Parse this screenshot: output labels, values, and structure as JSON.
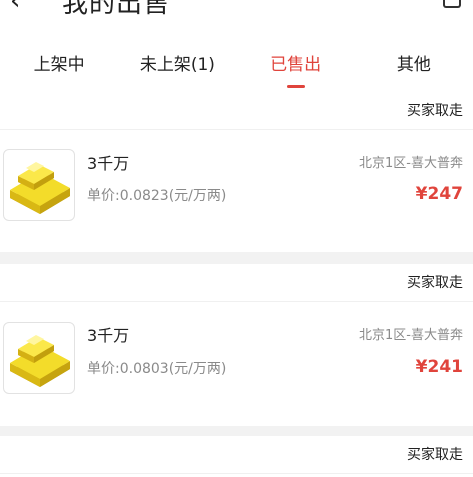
{
  "header": {
    "back_icon": "chevron-left-icon",
    "title": "我的出售",
    "menu_icon": "menu-icon"
  },
  "tabs": [
    {
      "label": "上架中",
      "active": false
    },
    {
      "label": "未上架(1)",
      "active": false
    },
    {
      "label": "已售出",
      "active": true
    },
    {
      "label": "其他",
      "active": false
    }
  ],
  "orders": [
    {
      "status": "买家取走",
      "name": "3千万",
      "unit_label": "单价:",
      "unit_value": "0.0823(元/万两)",
      "server": "北京1区-喜大普奔",
      "currency": "¥",
      "price": "247",
      "thumb_icon": "gold-bars-icon"
    },
    {
      "status": "买家取走",
      "name": "3千万",
      "unit_label": "单价:",
      "unit_value": "0.0803(元/万两)",
      "server": "北京1区-喜大普奔",
      "currency": "¥",
      "price": "241",
      "thumb_icon": "gold-bars-icon"
    },
    {
      "status": "买家取走"
    }
  ],
  "colors": {
    "accent": "#e0443c",
    "muted": "#8a8a8a",
    "background": "#f2f2f2",
    "gold": "#e8c81a"
  }
}
